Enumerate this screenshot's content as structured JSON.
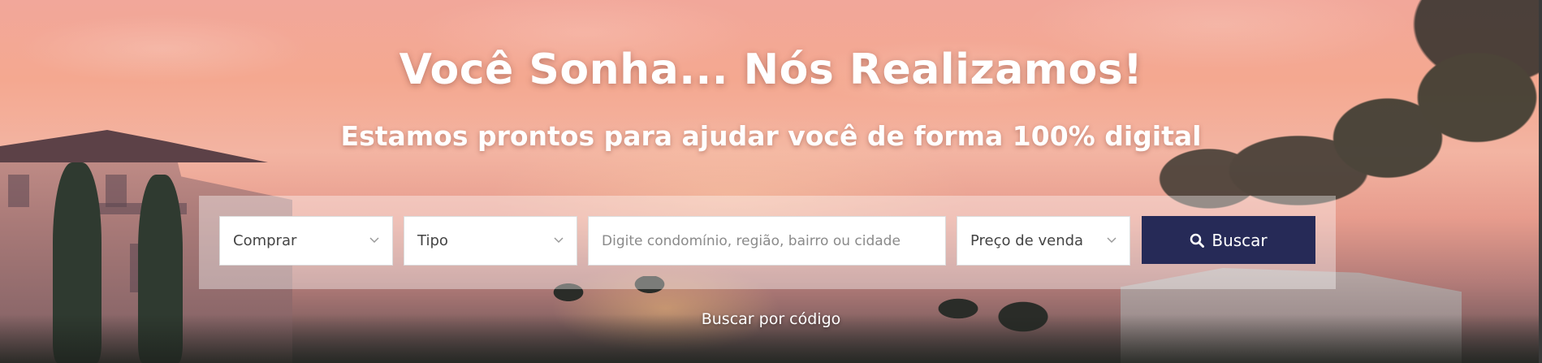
{
  "hero": {
    "headline": "Você Sonha... Nós Realizamos!",
    "subheadline": "Estamos prontos para ajudar você de forma 100% digital"
  },
  "search": {
    "purpose_select": {
      "value": "Comprar",
      "icon": "chevron-down-icon"
    },
    "type_select": {
      "value": "Tipo",
      "icon": "chevron-down-icon"
    },
    "location_input": {
      "placeholder": "Digite condomínio, região, bairro ou cidade",
      "value": ""
    },
    "price_select": {
      "value": "Preço de venda",
      "icon": "chevron-down-icon"
    },
    "submit": {
      "label": "Buscar",
      "icon": "search-icon",
      "background": "#262a57"
    }
  },
  "code_search_link": "Buscar por código"
}
